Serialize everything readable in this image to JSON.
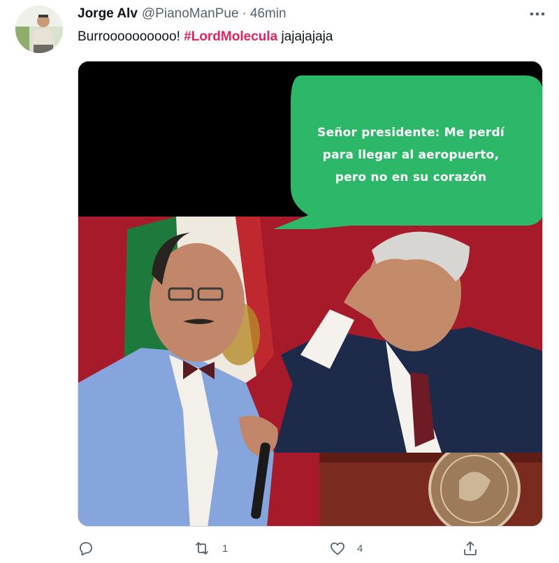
{
  "tweet": {
    "display_name": "Jorge Alv",
    "handle": "@PianoManPue",
    "separator": "·",
    "time": "46min",
    "text_before": "Burroooooooooo! ",
    "hashtag": "#LordMolecula",
    "text_after": " jajajajaja"
  },
  "media": {
    "speech_lines": [
      "Señor presidente: Me perdí",
      "para llegar al aeropuerto,",
      "pero no en su corazón"
    ],
    "colors": {
      "bubble": "#2db768",
      "backdrop_red": "#b31e2e",
      "top_black": "#000000"
    }
  },
  "actions": {
    "reply": {
      "icon": "reply-icon",
      "count": ""
    },
    "retweet": {
      "icon": "retweet-icon",
      "count": "1"
    },
    "like": {
      "icon": "like-icon",
      "count": "4"
    },
    "share": {
      "icon": "share-icon",
      "count": ""
    }
  },
  "colors": {
    "hashtag": "#e0245e",
    "secondary_text": "#536471"
  }
}
